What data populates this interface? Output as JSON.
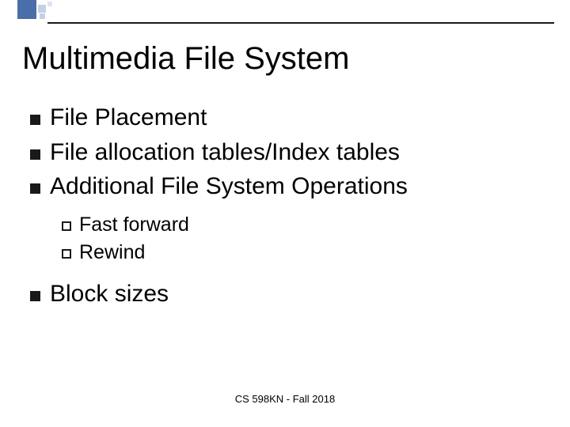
{
  "slide": {
    "title": "Multimedia File System",
    "bullets": [
      {
        "text": "File Placement"
      },
      {
        "text": "File allocation tables/Index tables"
      },
      {
        "text": "Additional File System Operations"
      }
    ],
    "subbullets": [
      {
        "text": "Fast forward"
      },
      {
        "text": "Rewind"
      }
    ],
    "bullets2": [
      {
        "text": "Block sizes"
      }
    ],
    "footer": "CS 598KN - Fall 2018"
  }
}
